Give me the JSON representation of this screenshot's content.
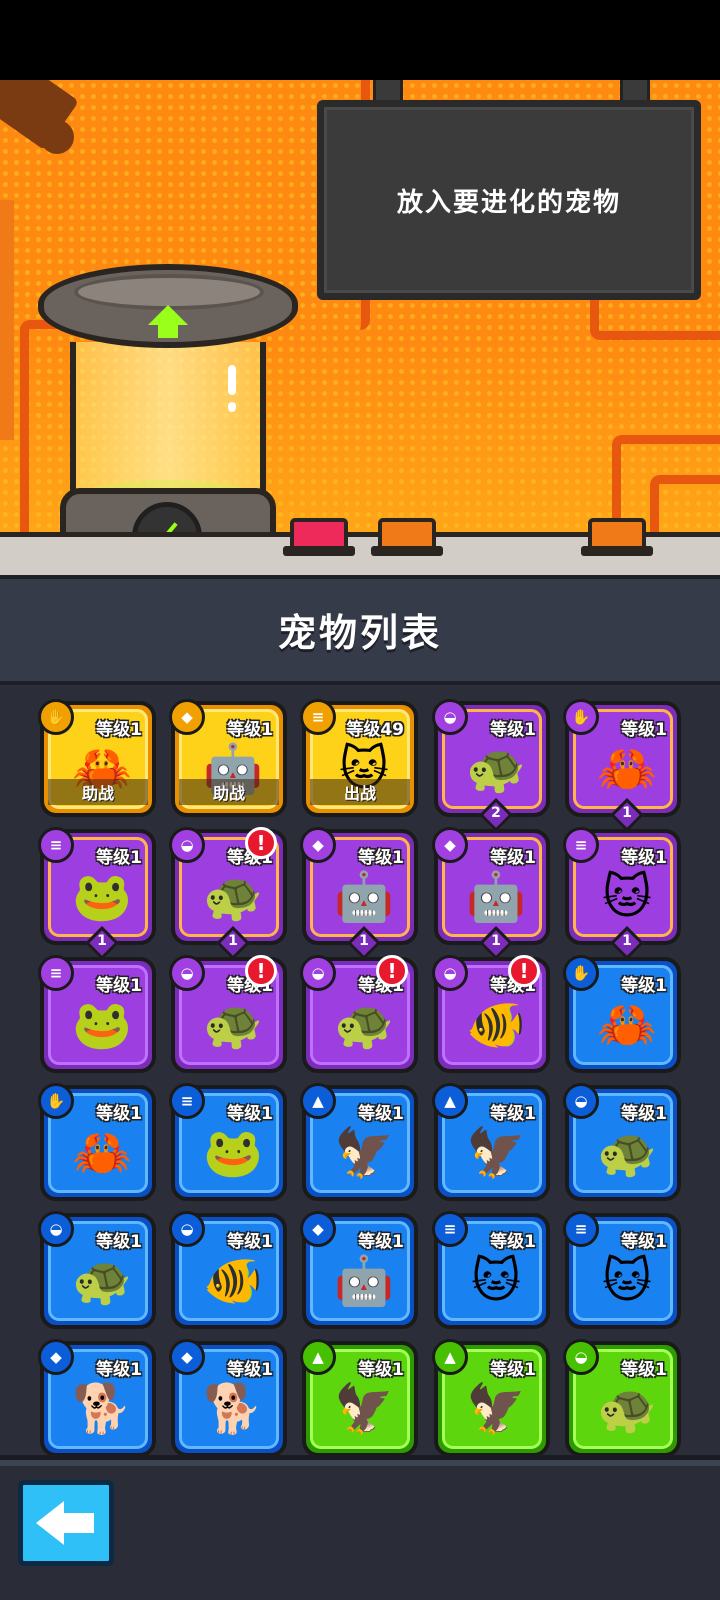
{
  "scene": {
    "sign_text": "放入要进化的宠物",
    "colors": {
      "background": "#ff8a12",
      "pipes": "#e8570f",
      "arrow": "#9aff1a"
    }
  },
  "pet_list": {
    "title": "宠物列表",
    "cards": [
      {
        "rarity": "yellow",
        "type_icon": "paw-icon",
        "pet": "crab",
        "level": "等级1",
        "status": "助战"
      },
      {
        "rarity": "yellow",
        "type_icon": "fox-icon",
        "pet": "robot",
        "level": "等级1",
        "status": "助战"
      },
      {
        "rarity": "yellow",
        "type_icon": "coin-stack-icon",
        "pet": "cat",
        "level": "等级49",
        "status": "出战"
      },
      {
        "rarity": "purple-gold",
        "type_icon": "shell-icon",
        "pet": "turtle",
        "level": "等级1",
        "stars": "2"
      },
      {
        "rarity": "purple-gold",
        "type_icon": "paw-icon",
        "pet": "crab",
        "level": "等级1",
        "stars": "1"
      },
      {
        "rarity": "purple-gold",
        "type_icon": "coin-stack-icon",
        "pet": "frog",
        "level": "等级1",
        "stars": "1"
      },
      {
        "rarity": "purple-gold",
        "type_icon": "shell-icon",
        "pet": "turtle",
        "level": "等级1",
        "stars": "1",
        "alert": "!"
      },
      {
        "rarity": "purple-gold",
        "type_icon": "fox-icon",
        "pet": "robot",
        "level": "等级1",
        "stars": "1"
      },
      {
        "rarity": "purple-gold",
        "type_icon": "fox-icon",
        "pet": "robot",
        "level": "等级1",
        "stars": "1"
      },
      {
        "rarity": "purple-gold",
        "type_icon": "coin-stack-icon",
        "pet": "cat",
        "level": "等级1",
        "stars": "1"
      },
      {
        "rarity": "purple",
        "type_icon": "coin-stack-icon",
        "pet": "frog",
        "level": "等级1"
      },
      {
        "rarity": "purple",
        "type_icon": "shell-icon",
        "pet": "turtle",
        "level": "等级1",
        "alert": "!"
      },
      {
        "rarity": "purple",
        "type_icon": "shell-icon",
        "pet": "turtle",
        "level": "等级1",
        "alert": "!"
      },
      {
        "rarity": "purple",
        "type_icon": "shell-icon",
        "pet": "goldfish",
        "level": "等级1",
        "alert": "!"
      },
      {
        "rarity": "blue",
        "type_icon": "paw-icon",
        "pet": "crab",
        "level": "等级1"
      },
      {
        "rarity": "blue",
        "type_icon": "paw-icon",
        "pet": "crab",
        "level": "等级1"
      },
      {
        "rarity": "blue",
        "type_icon": "coin-stack-icon",
        "pet": "frog",
        "level": "等级1"
      },
      {
        "rarity": "blue",
        "type_icon": "eagle-icon",
        "pet": "eagle",
        "level": "等级1"
      },
      {
        "rarity": "blue",
        "type_icon": "eagle-icon",
        "pet": "eagle",
        "level": "等级1"
      },
      {
        "rarity": "blue",
        "type_icon": "shell-icon",
        "pet": "turtle",
        "level": "等级1"
      },
      {
        "rarity": "blue",
        "type_icon": "shell-icon",
        "pet": "turtle",
        "level": "等级1"
      },
      {
        "rarity": "blue",
        "type_icon": "shell-icon",
        "pet": "goldfish",
        "level": "等级1"
      },
      {
        "rarity": "blue",
        "type_icon": "fox-icon",
        "pet": "robot",
        "level": "等级1"
      },
      {
        "rarity": "blue",
        "type_icon": "coin-stack-icon",
        "pet": "cat",
        "level": "等级1"
      },
      {
        "rarity": "blue",
        "type_icon": "coin-stack-icon",
        "pet": "cat",
        "level": "等级1"
      },
      {
        "rarity": "blue",
        "type_icon": "fox-icon",
        "pet": "dog",
        "level": "等级1"
      },
      {
        "rarity": "blue",
        "type_icon": "fox-icon",
        "pet": "dog",
        "level": "等级1"
      },
      {
        "rarity": "green",
        "type_icon": "eagle-icon",
        "pet": "eagle",
        "level": "等级1"
      },
      {
        "rarity": "green",
        "type_icon": "eagle-icon",
        "pet": "eagle",
        "level": "等级1"
      },
      {
        "rarity": "green",
        "type_icon": "shell-icon",
        "pet": "turtle",
        "level": "等级1"
      }
    ]
  },
  "footer": {
    "back_icon": "back-arrow-icon"
  }
}
